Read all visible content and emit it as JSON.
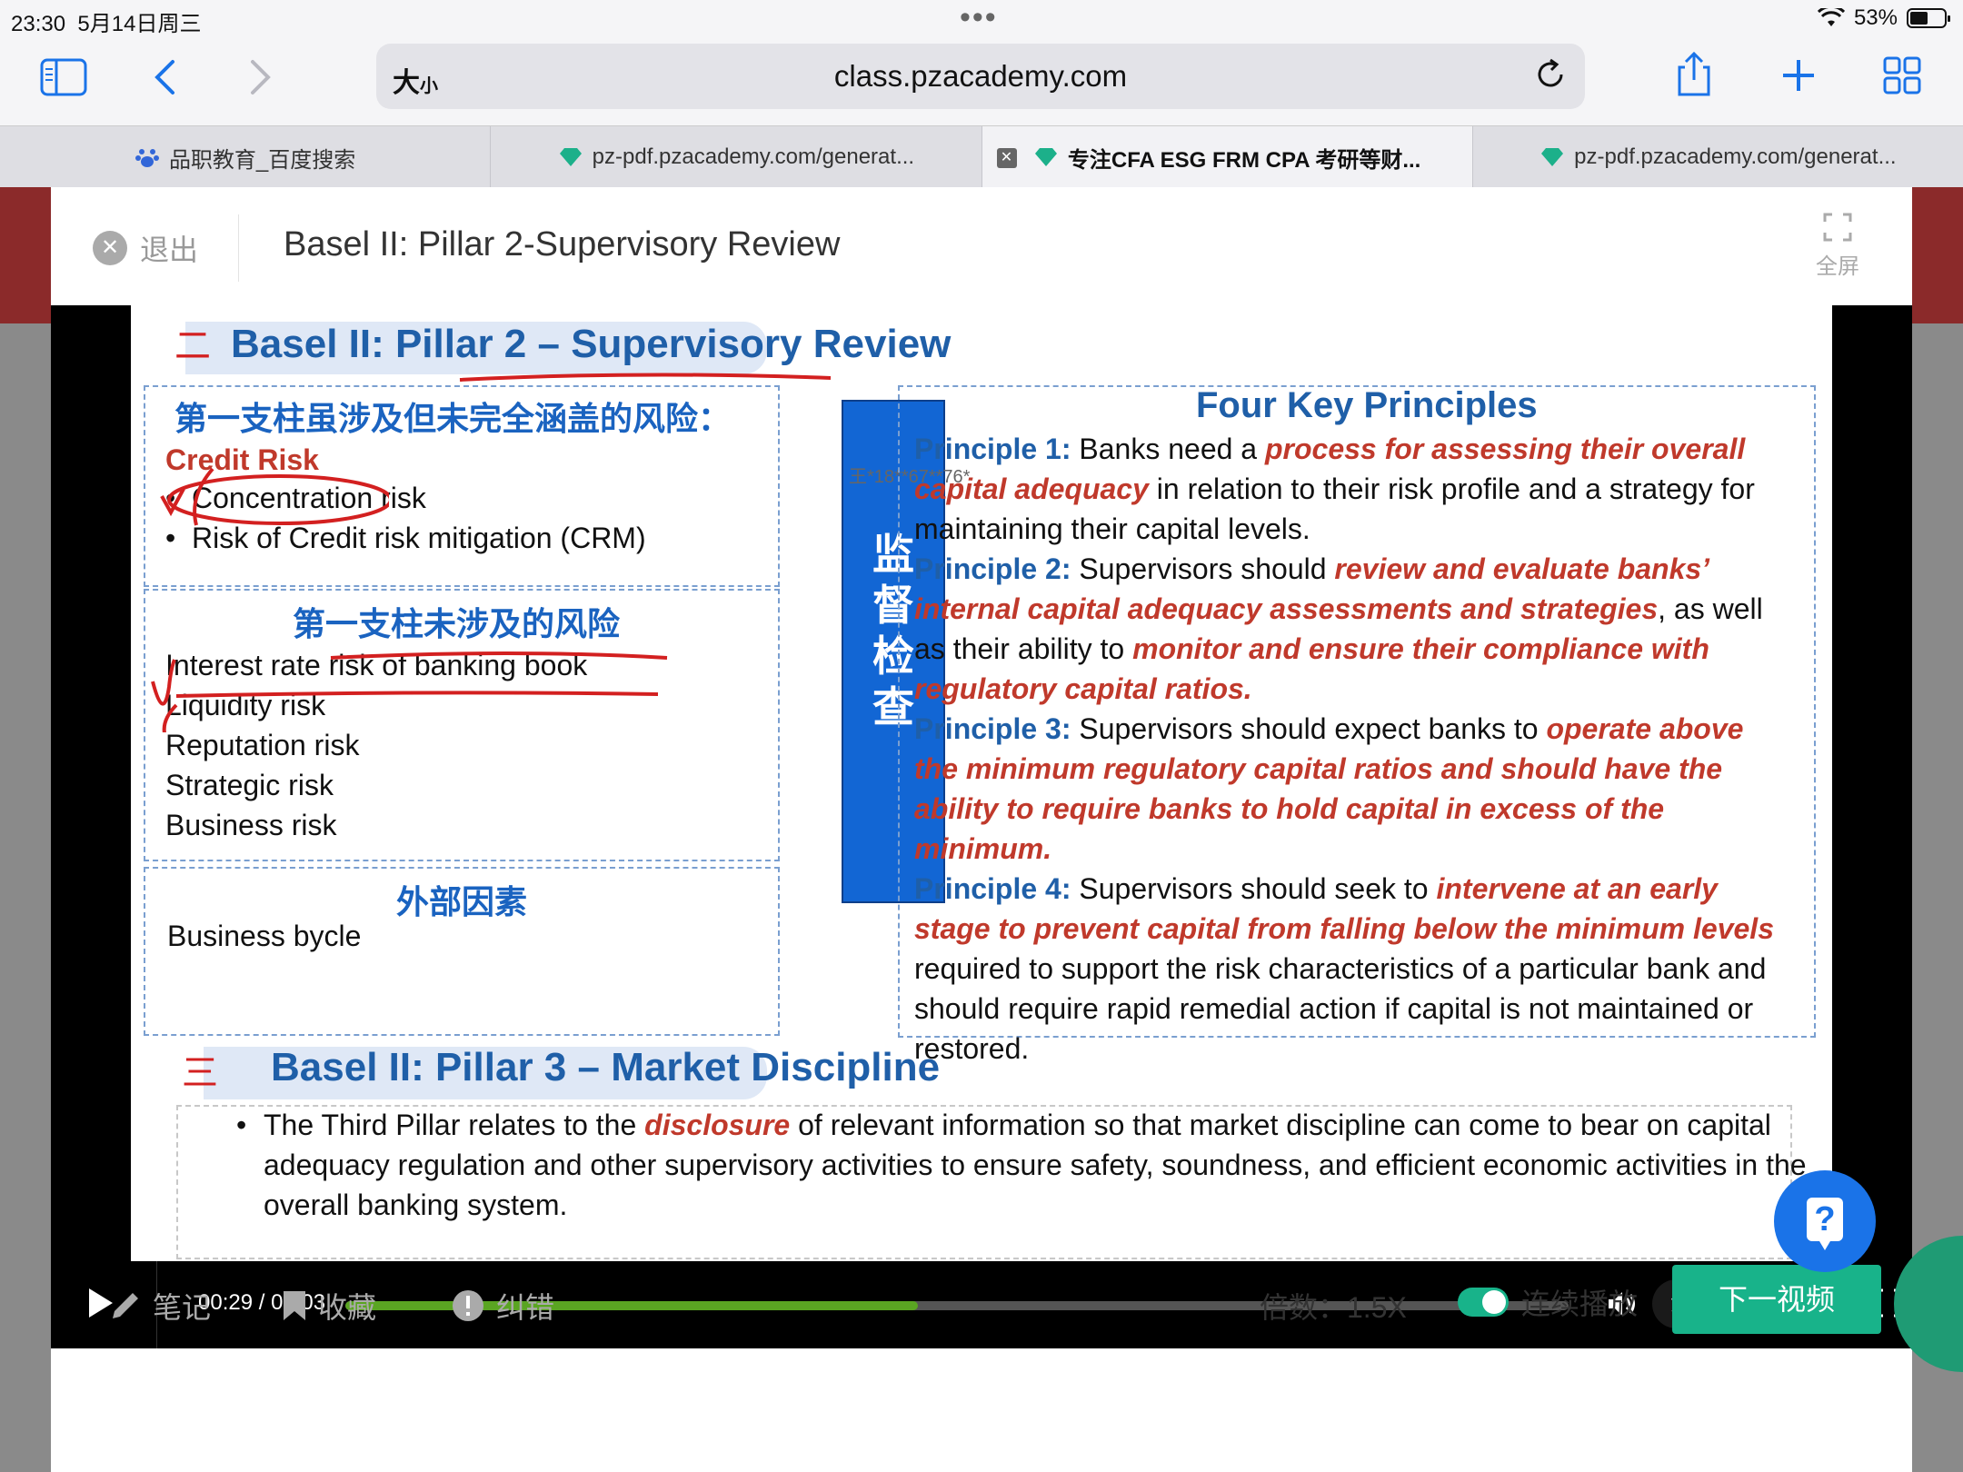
{
  "status_bar": {
    "time": "23:30",
    "date": "5月14日周三",
    "battery": "53%",
    "battery_level": 0.53
  },
  "browser": {
    "size_label_big": "大",
    "size_label_small": "小",
    "url": "class.pzacademy.com",
    "tabs": [
      {
        "label": "品职教育_百度搜索",
        "active": false
      },
      {
        "label": "pz-pdf.pzacademy.com/generat...",
        "active": false
      },
      {
        "label": "专注CFA ESG FRM CPA 考研等财...",
        "active": true
      },
      {
        "label": "pz-pdf.pzacademy.com/generat...",
        "active": false
      }
    ]
  },
  "player": {
    "exit_label": "退出",
    "title": "Basel II: Pillar 2-Supervisory Review",
    "fullscreen_label": "全屏",
    "time_display": "00:29 / 01:03",
    "progress": 0.468,
    "quality": "流畅"
  },
  "slide": {
    "section2_num": "二",
    "section2_title": "Basel II: Pillar 2 – Supervisory Review",
    "box1_heading": "第一支柱虽涉及但未完全涵盖的风险：",
    "credit_risk": "Credit Risk",
    "box1_items": [
      "Concentration risk",
      "Risk of Credit risk mitigation (CRM)"
    ],
    "box2_heading": "第一支柱未涉及的风险",
    "box2_items": [
      "Interest rate risk of banking book",
      "Liquidity risk",
      "Reputation risk",
      "Strategic risk",
      "Business risk"
    ],
    "box3_heading": "外部因素",
    "box3_items": [
      "Business bycle"
    ],
    "vertical_label": "监督检查",
    "watermark": "王*18**67**76*",
    "fkp_title": "Four Key Principles",
    "principles": [
      {
        "label": "Principle 1:",
        "t1": " Banks need a ",
        "e1": "process for assessing their overall capital adequacy",
        "t2": " in relation to their risk profile and a strategy for maintaining their capital levels.",
        "e2": "",
        "t3": ""
      },
      {
        "label": "Principle 2:",
        "t1": " Supervisors should ",
        "e1": "review and evaluate banks’ internal capital adequacy assessments and strategies",
        "t2": ", as well as their ability to ",
        "e2": "monitor and ensure their compliance with regulatory capital ratios.",
        "t3": ""
      },
      {
        "label": "Principle 3:",
        "t1": " Supervisors should expect banks to ",
        "e1": "operate above the minimum regulatory capital ratios and should have the ability to require banks to hold capital in excess of the minimum.",
        "t2": "",
        "e2": "",
        "t3": ""
      },
      {
        "label": "Principle 4:",
        "t1": " Supervisors should seek to ",
        "e1": "intervene at an early stage to prevent capital from falling below the minimum levels",
        "t2": " required to support the risk characteristics of a particular bank and should require rapid remedial action if capital is not maintained or restored.",
        "e2": "",
        "t3": ""
      }
    ],
    "section3_num": "三",
    "section3_title": "Basel II: Pillar 3 – Market Discipline",
    "pillar3_t1": "The Third Pillar relates to the ",
    "pillar3_em": "disclosure",
    "pillar3_t2": " of relevant information so that market discipline can come to bear on capital adequacy regulation and other supervisory activities to ensure safety, soundness, and efficient economic activities in the overall banking system."
  },
  "bottom_bar": {
    "notes": "笔记",
    "favorite": "收藏",
    "report": "纠错",
    "speed": "倍数：1.5X",
    "autoplay": "连续播放",
    "next": "下一视频"
  }
}
